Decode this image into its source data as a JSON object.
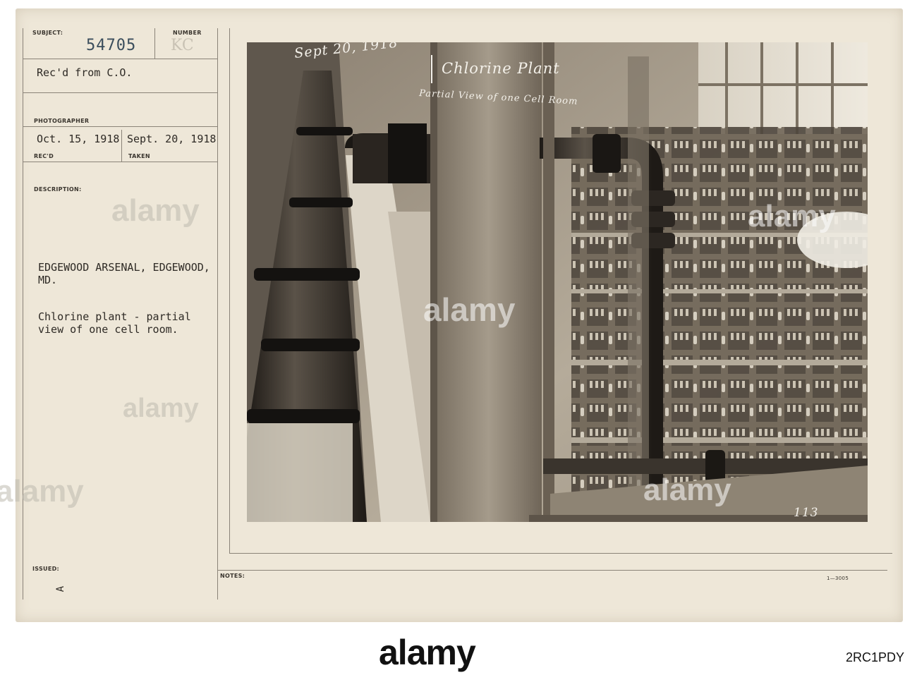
{
  "card": {
    "subject_label": "SUBJECT:",
    "number_label": "NUMBER",
    "subject_number": "54705",
    "number_stamp": "KC",
    "received_from": "Rec'd from C.O.",
    "photographer_label": "PHOTOGRAPHER",
    "recd_date": "Oct. 15, 1918",
    "taken_date": "Sept. 20, 1918",
    "recd_label": "REC'D",
    "taken_label": "TAKEN",
    "description_label": "DESCRIPTION:",
    "location_line1": "EDGEWOOD ARSENAL, EDGEWOOD,",
    "location_line2": "MD.",
    "caption_line1": "Chlorine plant - partial",
    "caption_line2": "view of one cell room.",
    "issued_label": "ISSUED:",
    "issued_mark": "A",
    "notes_label": "NOTES:",
    "form_number": "1—3005"
  },
  "photo": {
    "date_inscription": "Sept 20, 1918",
    "title_inscription": "Chlorine Plant",
    "subtitle_inscription": "Partial View of one Cell Room",
    "plate_number": "113"
  },
  "watermark": {
    "text": "alamy"
  },
  "footer": {
    "logo": "alamy",
    "image_id": "2RC1PDY"
  }
}
